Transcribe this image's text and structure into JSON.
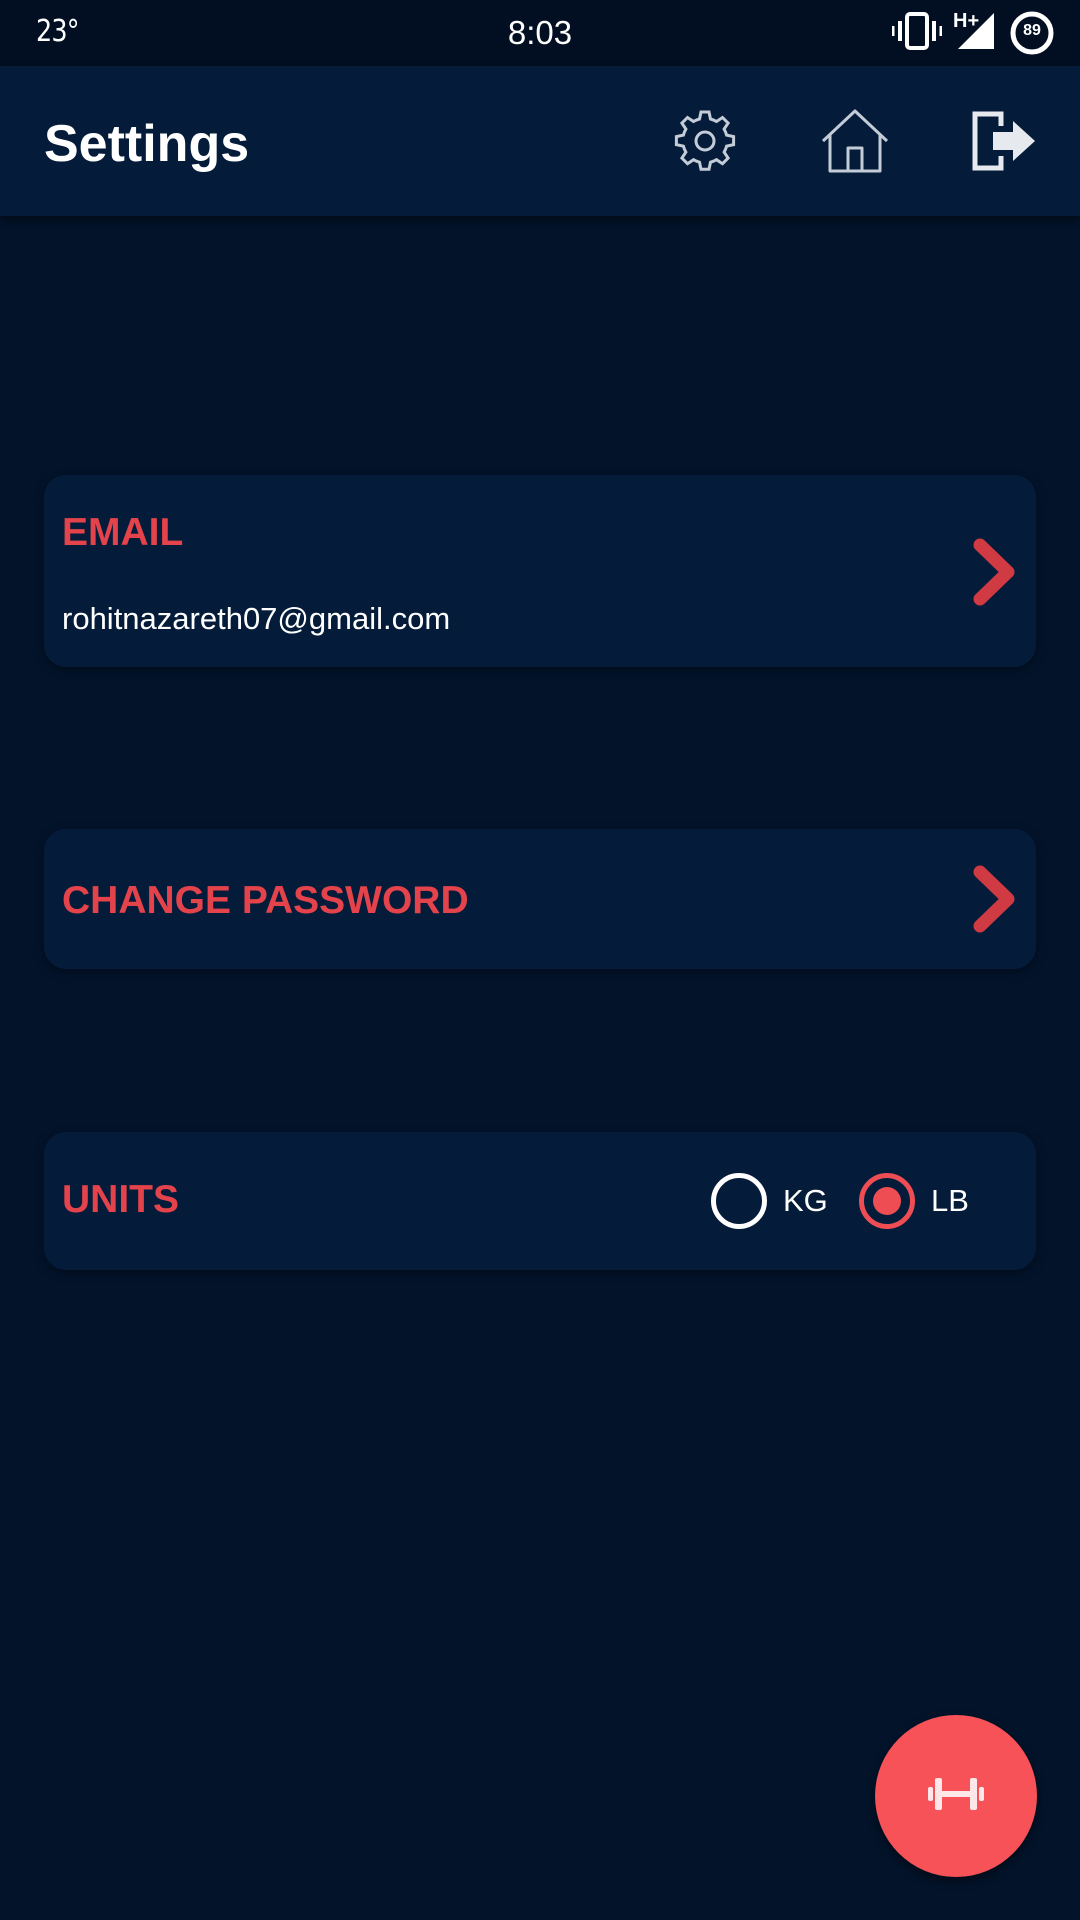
{
  "status_bar": {
    "temperature": "23°",
    "time": "8:03",
    "network": "H+",
    "battery": "89"
  },
  "app_bar": {
    "title": "Settings",
    "icons": [
      "gear-icon",
      "home-icon",
      "logout-icon"
    ]
  },
  "email_card": {
    "title": "EMAIL",
    "value": "rohitnazareth07@gmail.com"
  },
  "password_card": {
    "title": "CHANGE PASSWORD"
  },
  "units_card": {
    "title": "UNITS",
    "options": [
      {
        "label": "KG",
        "selected": false
      },
      {
        "label": "LB",
        "selected": true
      }
    ]
  },
  "fab": {
    "icon": "dumbbell-icon"
  },
  "colors": {
    "background": "#03132a",
    "card": "#041c3a",
    "accent": "#e4434b",
    "fab": "#f65257"
  }
}
